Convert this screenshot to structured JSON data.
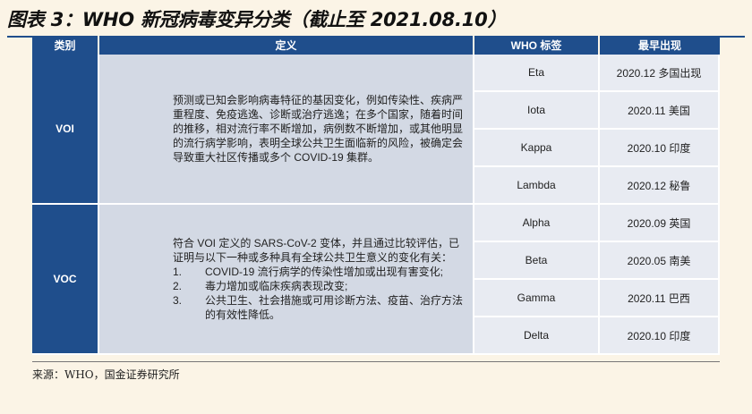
{
  "title": "图表 3：WHO 新冠病毒变异分类（截止至 2021.08.10）",
  "headers": [
    "类别",
    "定义",
    "WHO 标签",
    "最早出现"
  ],
  "groups": [
    {
      "category": "VOI",
      "definition": "预测或已知会影响病毒特征的基因变化，例如传染性、疾病严重程度、免疫逃逸、诊断或治疗逃逸；在多个国家，随着时间的推移，相对流行率不断增加，病例数不断增加，或其他明显的流行病学影响，表明全球公共卫生面临新的风险，被确定会导致重大社区传播或多个 COVID-19 集群。",
      "rows": [
        {
          "label": "Eta",
          "first": "2020.12 多国出现"
        },
        {
          "label": "Iota",
          "first": "2020.11 美国"
        },
        {
          "label": "Kappa",
          "first": "2020.10 印度"
        },
        {
          "label": "Lambda",
          "first": "2020.12 秘鲁"
        }
      ]
    },
    {
      "category": "VOC",
      "definition_intro": "符合 VOI 定义的 SARS-CoV-2 变体，并且通过比较评估，已证明与以下一种或多种具有全球公共卫生意义的变化有关：",
      "definition_items": [
        {
          "num": "1.",
          "text": "COVID-19 流行病学的传染性增加或出现有害变化;"
        },
        {
          "num": "2.",
          "text": "毒力增加或临床疾病表现改变;"
        },
        {
          "num": "3.",
          "text": "公共卫生、社会措施或可用诊断方法、疫苗、治疗方法的有效性降低。"
        }
      ],
      "rows": [
        {
          "label": "Alpha",
          "first": "2020.09 英国"
        },
        {
          "label": "Beta",
          "first": "2020.05 南美"
        },
        {
          "label": "Gamma",
          "first": "2020.11 巴西"
        },
        {
          "label": "Delta",
          "first": "2020.10 印度"
        }
      ]
    }
  ],
  "source": "来源：WHO，国金证券研究所"
}
